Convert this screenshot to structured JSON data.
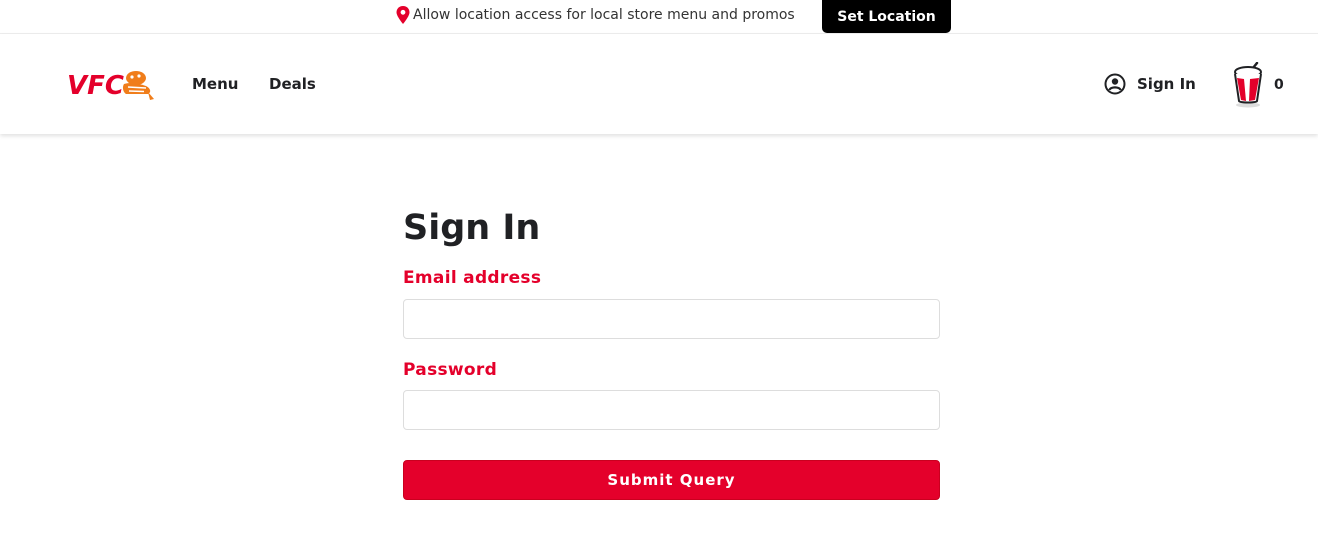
{
  "topbar": {
    "location_message": "Allow location access for local store menu and promos",
    "set_location_label": "Set Location",
    "pin_icon": "location-pin-icon",
    "pin_color": "#e4002b"
  },
  "header": {
    "logo_text": "VFC",
    "nav": {
      "menu_label": "Menu",
      "deals_label": "Deals"
    },
    "sign_in_label": "Sign In",
    "user_icon": "user-circle-icon",
    "cart_icon": "bucket-icon",
    "cart_count": "0"
  },
  "form": {
    "title": "Sign In",
    "email_label": "Email address",
    "email_value": "",
    "password_label": "Password",
    "password_value": "",
    "submit_label": "Submit Query"
  },
  "colors": {
    "brand_red": "#e4002b",
    "logo_orange": "#f07d1a",
    "dark_text": "#202124",
    "black": "#000000"
  }
}
